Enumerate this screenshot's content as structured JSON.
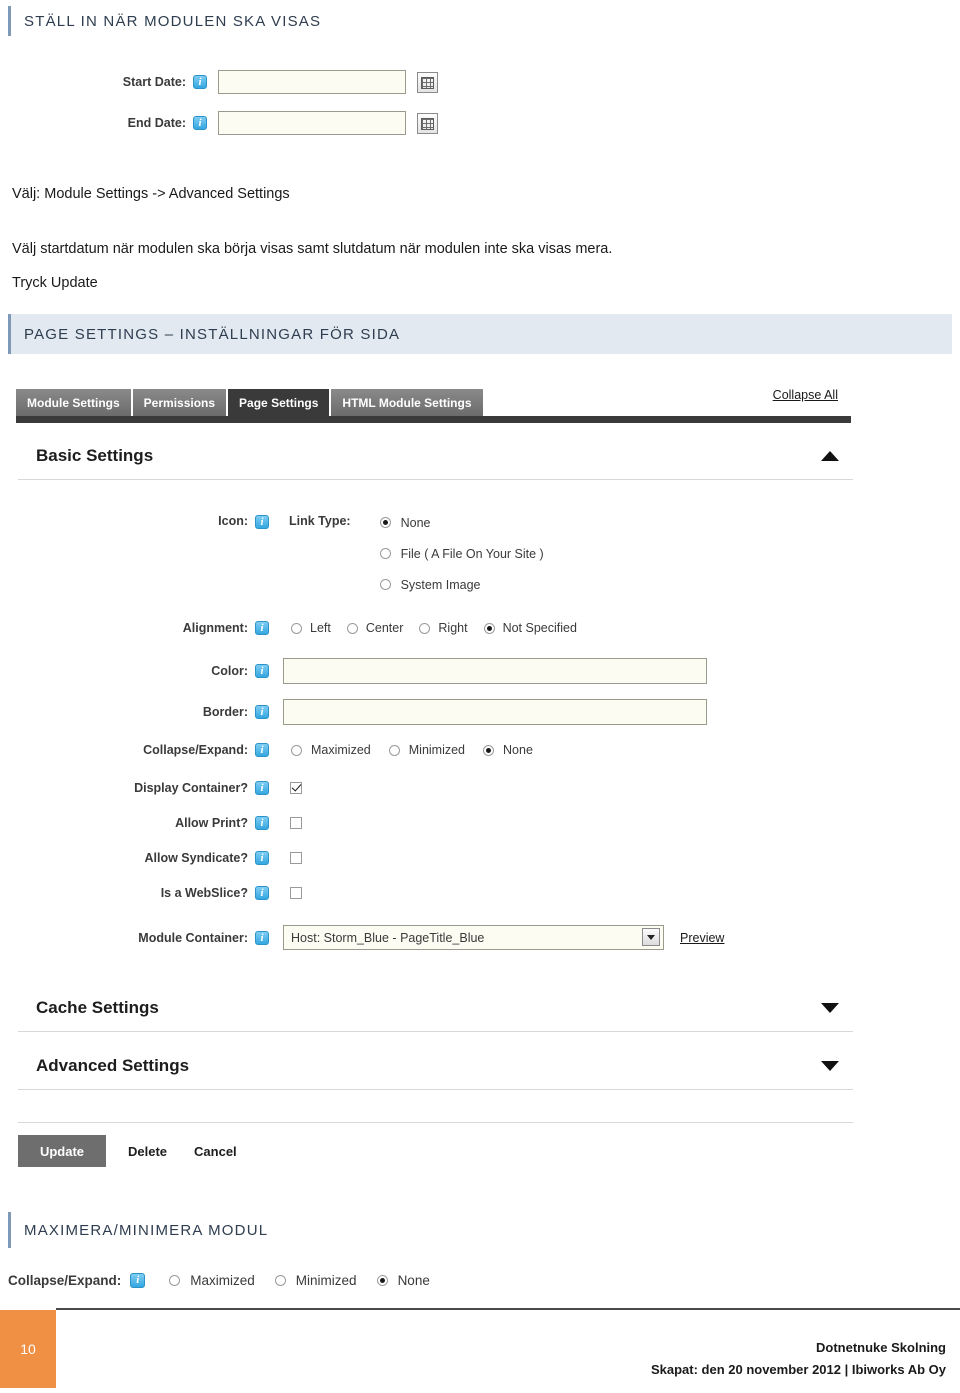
{
  "sections": {
    "heading1": "STÄLL IN NÄR MODULEN SKA VISAS",
    "heading2": "PAGE SETTINGS – INSTÄLLNINGAR FÖR SIDA",
    "heading3": "MAXIMERA/MINIMERA MODUL"
  },
  "date_form": {
    "start_label": "Start Date:",
    "start_value": "",
    "end_label": "End Date:",
    "end_value": "",
    "info_icon": "info-icon",
    "calendar_icon": "calendar-icon"
  },
  "body_text": {
    "line1": "Välj: Module Settings -> Advanced Settings",
    "line2": "Välj startdatum när modulen ska börja visas samt slutdatum när modulen inte ska visas mera.",
    "line3": "Tryck Update"
  },
  "tabs": [
    {
      "label": "Module Settings",
      "active": false
    },
    {
      "label": "Permissions",
      "active": false
    },
    {
      "label": "Page Settings",
      "active": true
    },
    {
      "label": "HTML Module Settings",
      "active": false
    }
  ],
  "collapse_all_label": "Collapse All",
  "panels": {
    "basic": {
      "title": "Basic Settings",
      "state": "expanded",
      "chevron": "chevron-up-icon"
    },
    "cache": {
      "title": "Cache Settings",
      "state": "collapsed",
      "chevron": "chevron-down-icon"
    },
    "advanced": {
      "title": "Advanced Settings",
      "state": "collapsed",
      "chevron": "chevron-down-icon"
    }
  },
  "basic_settings": {
    "icon_label": "Icon:",
    "link_type_label": "Link Type:",
    "link_type_options": [
      {
        "label": "None",
        "selected": true
      },
      {
        "label": "File ( A File On Your Site )",
        "selected": false
      },
      {
        "label": "System Image",
        "selected": false
      }
    ],
    "alignment_label": "Alignment:",
    "alignment_options": [
      {
        "label": "Left",
        "selected": false
      },
      {
        "label": "Center",
        "selected": false
      },
      {
        "label": "Right",
        "selected": false
      },
      {
        "label": "Not Specified",
        "selected": true
      }
    ],
    "color_label": "Color:",
    "color_value": "",
    "border_label": "Border:",
    "border_value": "",
    "collapse_expand_label": "Collapse/Expand:",
    "collapse_expand_options": [
      {
        "label": "Maximized",
        "selected": false
      },
      {
        "label": "Minimized",
        "selected": false
      },
      {
        "label": "None",
        "selected": true
      }
    ],
    "checkboxes": [
      {
        "label": "Display Container?",
        "checked": true
      },
      {
        "label": "Allow Print?",
        "checked": false
      },
      {
        "label": "Allow Syndicate?",
        "checked": false
      },
      {
        "label": "Is a WebSlice?",
        "checked": false
      }
    ],
    "module_container_label": "Module Container:",
    "module_container_value": "Host: Storm_Blue - PageTitle_Blue",
    "preview_label": "Preview"
  },
  "action_buttons": {
    "update": "Update",
    "delete": "Delete",
    "cancel": "Cancel"
  },
  "maximize_section": {
    "collapse_expand_label": "Collapse/Expand:",
    "options": [
      {
        "label": "Maximized",
        "selected": false
      },
      {
        "label": "Minimized",
        "selected": false
      },
      {
        "label": "None",
        "selected": true
      }
    ]
  },
  "footer": {
    "page_number": "10",
    "title": "Dotnetnuke Skolning",
    "credit": "Skapat: den 20 november 2012 | Ibiworks Ab Oy"
  },
  "colors": {
    "accent_blue": "#7e9ab8",
    "band_blue": "#e2e9f1",
    "footer_orange": "#ef9045",
    "tab_active": "#3a3a3a"
  }
}
